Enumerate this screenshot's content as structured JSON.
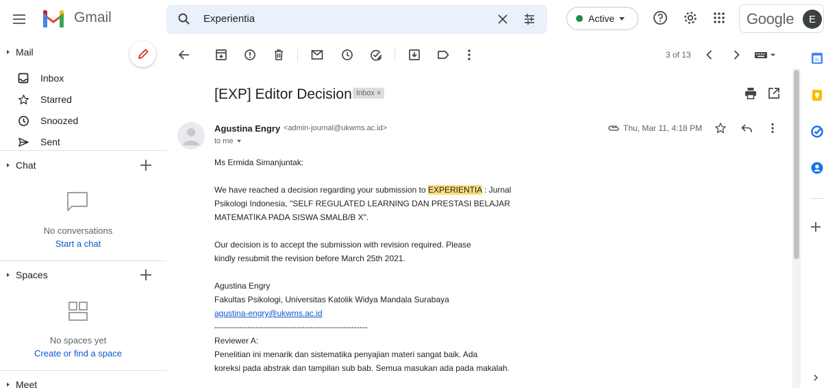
{
  "app": {
    "name": "Gmail"
  },
  "search": {
    "value": "Experientia"
  },
  "header": {
    "status_label": "Active",
    "account_brand": "Google",
    "account_initial": "E"
  },
  "nav": {
    "mail_heading": "Mail",
    "items": [
      {
        "label": "Inbox",
        "icon": "inbox-icon"
      },
      {
        "label": "Starred",
        "icon": "star-icon"
      },
      {
        "label": "Snoozed",
        "icon": "clock-icon"
      },
      {
        "label": "Sent",
        "icon": "send-icon"
      }
    ],
    "chat_heading": "Chat",
    "chat_empty": "No conversations",
    "chat_link": "Start a chat",
    "spaces_heading": "Spaces",
    "spaces_empty": "No spaces yet",
    "spaces_link": "Create or find a space",
    "meet_heading": "Meet"
  },
  "toolbar": {
    "count": "3 of 13"
  },
  "message": {
    "subject": "[EXP] Editor Decision",
    "label": "Inbox ×",
    "sender_name": "Agustina Engry",
    "sender_email": "<admin-journal@ukwms.ac.id>",
    "recipient": "to me",
    "date": "Thu, Mar 11, 4:18 PM",
    "greeting": "Ms Ermida Simanjuntak:",
    "p1_before": "We have reached a decision regarding your submission to ",
    "p1_highlight": "EXPERIENTIA",
    "p1_after": " : Jurnal",
    "p1_line2": "Psikologi Indonesia, \"SELF REGULATED LEARNING DAN PRESTASI BELAJAR",
    "p1_line3": "MATEMATIKA PADA SISWA SMALB/B X\".",
    "p2_line1": "Our decision is to accept the submission with revision required. Please",
    "p2_line2": "kindly resubmit the revision before March 25th 2021.",
    "sig_name": "Agustina Engry",
    "sig_org": "Fakultas Psikologi, Universitas Katolik Widya Mandala Surabaya",
    "sig_email": "agustina-engry@ukwms.ac.id",
    "separator": "--------------------------------------------------------",
    "reviewer_heading": "Reviewer A:",
    "reviewer_line1": "Penelitian ini menarik dan sistematika penyajian materi sangat baik. Ada",
    "reviewer_line2": "koreksi pada abstrak dan tampilan sub bab. Semua masukan ada pada makalah.",
    "separator2": "--------------------------------------------------------"
  },
  "colors": {
    "accent": "#0b57d0",
    "active_green": "#1e8e3e",
    "highlight": "#fddc7a",
    "search_bg": "#eaf1fb"
  }
}
